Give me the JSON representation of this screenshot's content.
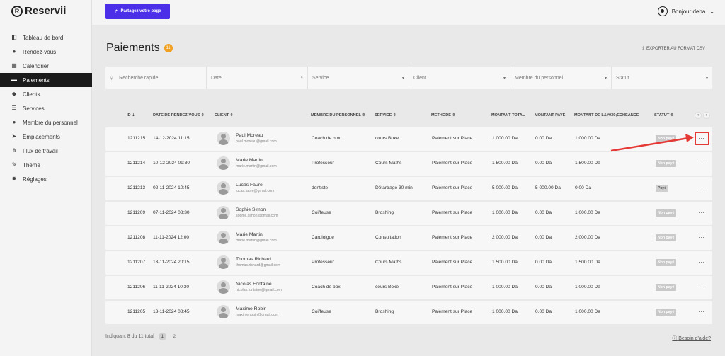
{
  "logo": "Reservii",
  "sidebar": {
    "items": [
      {
        "label": "Tableau de bord",
        "icon": "dashboard-icon"
      },
      {
        "label": "Rendez-vous",
        "icon": "clock-icon"
      },
      {
        "label": "Calendrier",
        "icon": "calendar-icon"
      },
      {
        "label": "Paiements",
        "icon": "wallet-icon",
        "active": true
      },
      {
        "label": "Clients",
        "icon": "users-icon"
      },
      {
        "label": "Services",
        "icon": "list-icon"
      },
      {
        "label": "Membre du personnel",
        "icon": "user-icon"
      },
      {
        "label": "Emplacements",
        "icon": "location-arrow-icon"
      },
      {
        "label": "Flux de travail",
        "icon": "workflow-icon"
      },
      {
        "label": "Thème",
        "icon": "brush-icon"
      },
      {
        "label": "Réglages",
        "icon": "gear-icon"
      }
    ]
  },
  "topbar": {
    "share_label": "Partagez votre page",
    "user_label": "Bonjour deba"
  },
  "page": {
    "title": "Paiements",
    "count": "11",
    "export_label": "EXPORTER AU FORMAT CSV"
  },
  "filters": {
    "search_placeholder": "Recherche rapide",
    "date": "Date",
    "service": "Service",
    "client": "Client",
    "staff": "Membre du personnel",
    "status": "Statut"
  },
  "table": {
    "headers": [
      "ID",
      "DATE DE RENDEZ-VOUS",
      "CLIENT",
      "MEMBRE DU PERSONNEL",
      "SERVICE",
      "METHODE",
      "MONTANT TOTAL",
      "MONTANT PAYÉ",
      "MONTANT DE L&#039;ÉCHÉANCE",
      "STATUT"
    ],
    "rows": [
      {
        "id": "1211215",
        "date": "14-12-2024 11:15",
        "name": "Paul Moreau",
        "email": "paul.moreau@gmail.com",
        "staff": "Coach de box",
        "service": "cours Boxe",
        "method": "Paiement sur Place",
        "total": "1 000.00 Da",
        "paid": "0.00 Da",
        "due": "1 000.00 Da",
        "status": "Non payé"
      },
      {
        "id": "1211214",
        "date": "10-12-2024 09:30",
        "name": "Marie Martin",
        "email": "marie.martin@gmail.com",
        "staff": "Professeur",
        "service": "Cours Maths",
        "method": "Paiement sur Place",
        "total": "1 500.00 Da",
        "paid": "0.00 Da",
        "due": "1 500.00 Da",
        "status": "Non payé"
      },
      {
        "id": "1211213",
        "date": "02-11-2024 10:45",
        "name": "Lucas Faure",
        "email": "lucas.faure@gmail.com",
        "staff": "dentiste",
        "service": "Détartrage 30 min",
        "method": "Paiement sur Place",
        "total": "5 000.00 Da",
        "paid": "5 000.00 Da",
        "due": "0.00 Da",
        "status": "Payé"
      },
      {
        "id": "1211209",
        "date": "07-11-2024 08:30",
        "name": "Sophie Simon",
        "email": "sophie.simon@gmail.com",
        "staff": "Coiffeuse",
        "service": "Broshing",
        "method": "Paiement sur Place",
        "total": "1 000.00 Da",
        "paid": "0.00 Da",
        "due": "1 000.00 Da",
        "status": "Non payé"
      },
      {
        "id": "1211208",
        "date": "11-11-2024 12:00",
        "name": "Marie Martin",
        "email": "marie.martin@gmail.com",
        "staff": "Cardiolgue",
        "service": "Consultation",
        "method": "Paiement sur Place",
        "total": "2 000.00 Da",
        "paid": "0.00 Da",
        "due": "2 000.00 Da",
        "status": "Non payé"
      },
      {
        "id": "1211207",
        "date": "13-11-2024 20:15",
        "name": "Thomas Richard",
        "email": "thomas.richard@gmail.com",
        "staff": "Professeur",
        "service": "Cours Maths",
        "method": "Paiement sur Place",
        "total": "1 500.00 Da",
        "paid": "0.00 Da",
        "due": "1 500.00 Da",
        "status": "Non payé"
      },
      {
        "id": "1211206",
        "date": "11-11-2024 10:30",
        "name": "Nicolas Fontaine",
        "email": "nicolas.fontaine@gmail.com",
        "staff": "Coach de box",
        "service": "cours Boxe",
        "method": "Paiement sur Place",
        "total": "1 000.00 Da",
        "paid": "0.00 Da",
        "due": "1 000.00 Da",
        "status": "Non payé"
      },
      {
        "id": "1211205",
        "date": "13-11-2024 08:45",
        "name": "Maxime Robin",
        "email": "maxime.robin@gmail.com",
        "staff": "Coiffeuse",
        "service": "Broshing",
        "method": "Paiement sur Place",
        "total": "1 000.00 Da",
        "paid": "0.00 Da",
        "due": "1 000.00 Da",
        "status": "Non payé"
      }
    ]
  },
  "footer": {
    "showing": "Indiquant 8 du 11 total",
    "page1": "1",
    "page2": "2",
    "help": "Besoin d'aide?"
  },
  "colors": {
    "accent": "#4a2ee8",
    "badge": "#f0a020",
    "annotation": "#e53935"
  }
}
